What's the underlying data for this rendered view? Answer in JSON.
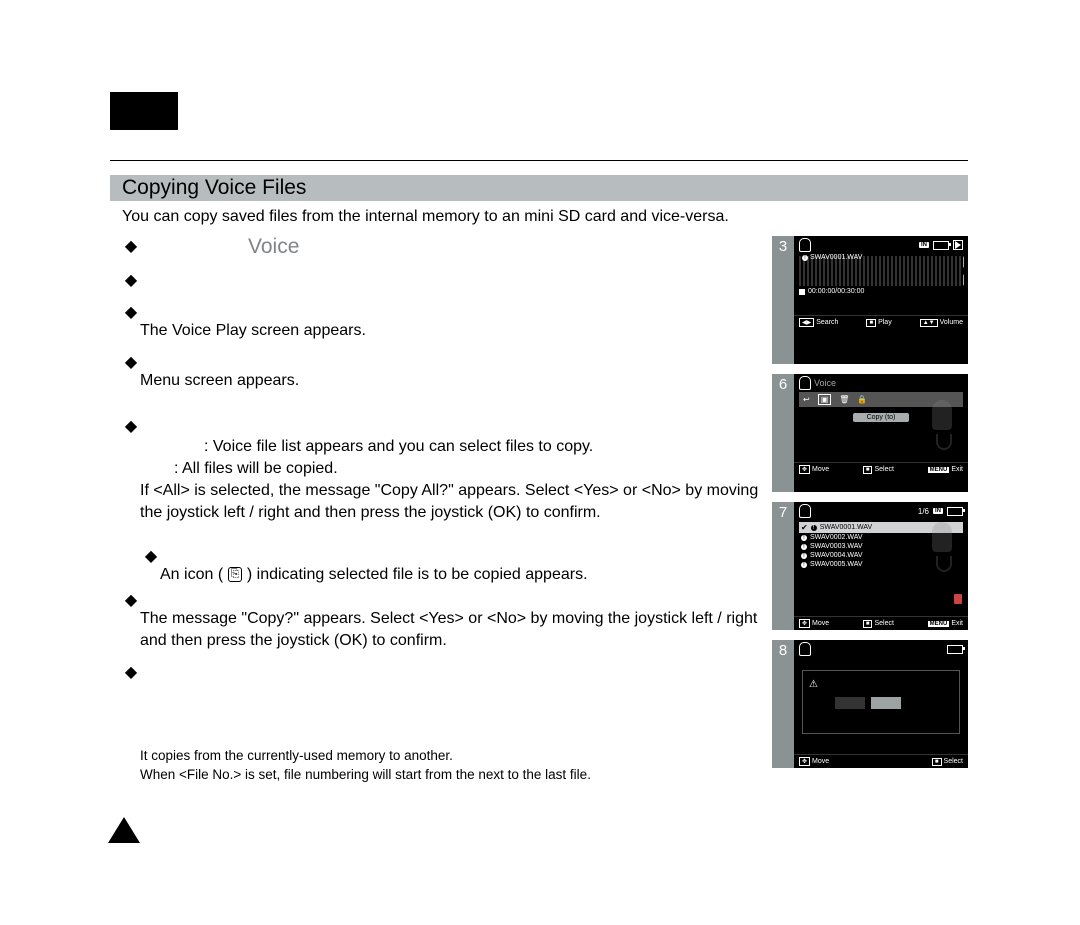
{
  "section_title": "Copying Voice Files",
  "intro": "You can copy saved files from the internal memory to an mini SD card and vice-versa.",
  "steps": {
    "step1_voice": "Voice",
    "step3": "The Voice Play screen appears.",
    "step4": "Menu screen appears.",
    "opt_selected": ": Voice file list appears and you can select files to copy.",
    "opt_all": ": All files will be copied.",
    "copy_all_note": "If <All> is selected, the message \"Copy All?\" appears. Select <Yes> or <No> by moving the joystick left / right and then press the joystick (OK) to confirm.",
    "step6_pre": "An icon (",
    "step6_post": ") indicating selected file is to be copied appears.",
    "step7": "The message \"Copy?\" appears. Select <Yes> or <No> by moving the joystick left / right and then press the joystick (OK) to confirm."
  },
  "notes": [
    "It copies from the currently-used memory to another.",
    "When <File No.> is set, file numbering will start from the next to the last file."
  ],
  "shots": {
    "common": {
      "menu": "MENU"
    },
    "s3": {
      "num": "3",
      "storage": "IN",
      "file": "SWAV0001.WAV",
      "time": "00:00:00/00:30:00",
      "hints": [
        "Search",
        "Play",
        "Volume"
      ]
    },
    "s6": {
      "num": "6",
      "title": "Voice",
      "option": "Copy (to)",
      "hints": [
        "Move",
        "Select",
        "Exit"
      ]
    },
    "s7": {
      "num": "7",
      "counter": "1/6",
      "storage": "IN",
      "files": [
        "SWAV0001.WAV",
        "SWAV0002.WAV",
        "SWAV0003.WAV",
        "SWAV0004.WAV",
        "SWAV0005.WAV"
      ],
      "hints": [
        "Move",
        "Select",
        "Exit"
      ]
    },
    "s8": {
      "num": "8",
      "hints": [
        "Move",
        "Select"
      ]
    }
  }
}
